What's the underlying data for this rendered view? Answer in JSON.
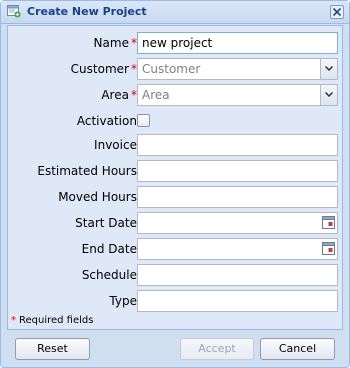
{
  "window": {
    "title": "Create New Project",
    "title_icon": "form-add-icon",
    "close_icon": "close-icon"
  },
  "form": {
    "name": {
      "label": "Name",
      "required": "*",
      "value": "new project"
    },
    "customer": {
      "label": "Customer",
      "required": "*",
      "placeholder": "Customer"
    },
    "area": {
      "label": "Area",
      "required": "*",
      "placeholder": "Area"
    },
    "activation": {
      "label": "Activation:",
      "checked": false
    },
    "invoice": {
      "label": "Invoice:",
      "value": ""
    },
    "estimated_hours": {
      "label": "Estimated Hours:",
      "value": ""
    },
    "moved_hours": {
      "label": "Moved Hours:",
      "value": ""
    },
    "start_date": {
      "label": "Start Date:",
      "value": "",
      "icon": "calendar-icon"
    },
    "end_date": {
      "label": "End Date:",
      "value": "",
      "icon": "calendar-icon"
    },
    "schedule": {
      "label": "Schedule:",
      "value": ""
    },
    "type": {
      "label": "Type:",
      "value": ""
    },
    "required_note": {
      "marker": "*",
      "text": "Required fields"
    }
  },
  "buttons": {
    "reset": "Reset",
    "accept": "Accept",
    "cancel": "Cancel"
  },
  "colors": {
    "title_text": "#15428b",
    "required_marker": "#dd0000",
    "panel_bg": "#dfe8f6",
    "window_bg": "#cfdff0"
  }
}
